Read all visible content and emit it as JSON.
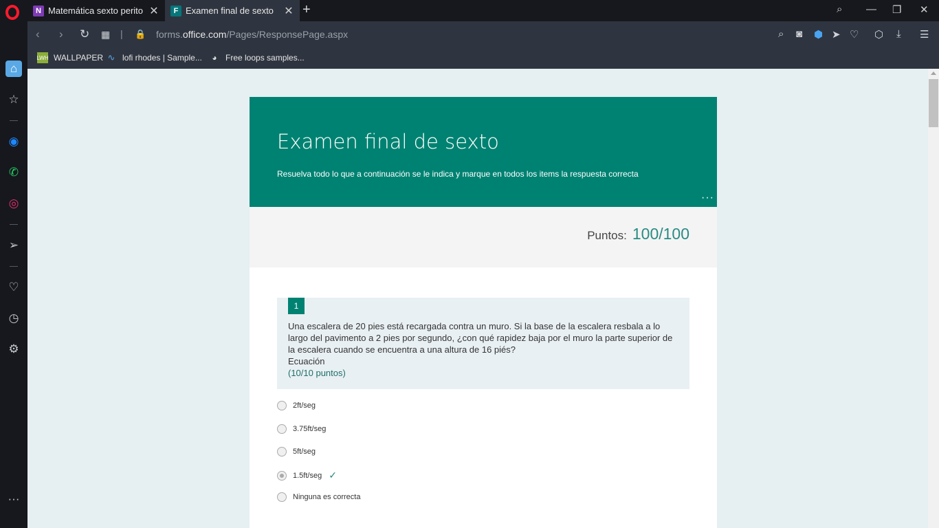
{
  "browser": {
    "tabs": [
      {
        "title": "Matemática sexto perito",
        "icon": "onenote-icon",
        "active": false
      },
      {
        "title": "Examen final de sexto",
        "icon": "forms-icon",
        "active": true
      }
    ],
    "url_prefix": "forms.",
    "url_domain": "office.com",
    "url_path": "/Pages/ResponsePage.aspx",
    "bookmarks": [
      {
        "label": "WALLPAPER",
        "icon": "lwh-icon"
      },
      {
        "label": "lofi rhodes | Sample...",
        "icon": "wave-icon"
      },
      {
        "label": "Free loops samples...",
        "icon": "loops-icon"
      }
    ],
    "new_tab": "+",
    "more_symbol": "···"
  },
  "form": {
    "title": "Examen final de sexto",
    "description": "Resuelva todo lo que a continuación se le indica y marque en todos los items la respuesta correcta",
    "more_symbol": "···",
    "score_label": "Puntos:",
    "score_value": "100/100",
    "question": {
      "number": "1",
      "text": "Una escalera de 20 pies está recargada contra un muro. Si la base de la escalera resbala a lo largo del pavimento a 2 pies por segundo, ¿con qué rapidez baja por el muro la parte superior de la escalera cuando se encuentra a una altura de 16 piés?",
      "subtitle": "Ecuación",
      "points": "(10/10 puntos)",
      "options": [
        {
          "label": "2ft/seg",
          "selected": false
        },
        {
          "label": "3.75ft/seg",
          "selected": false
        },
        {
          "label": "5ft/seg",
          "selected": false
        },
        {
          "label": "1.5ft/seg",
          "selected": true,
          "correct_mark": "✓"
        },
        {
          "label": "Ninguna es correcta",
          "selected": false
        }
      ]
    }
  },
  "colors": {
    "header": "#008272",
    "accent": "#2a8b83",
    "page_bg": "#e6eff2"
  }
}
